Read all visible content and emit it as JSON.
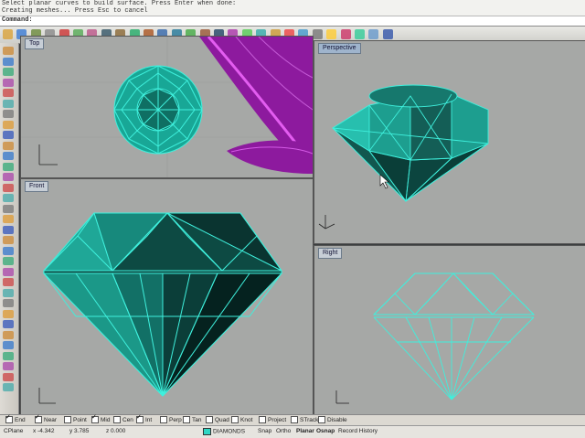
{
  "command": {
    "history_line_1": "Select planar curves to build surface. Press Enter when done:",
    "history_line_2": "Creating meshes... Press Esc to cancel",
    "prompt": "Command:"
  },
  "viewports": {
    "top": {
      "title": "Top"
    },
    "perspective": {
      "title": "Perspective"
    },
    "front": {
      "title": "Front"
    },
    "right": {
      "title": "Right"
    }
  },
  "osnap": {
    "items": [
      {
        "label": "End",
        "checked": true
      },
      {
        "label": "Near",
        "checked": true
      },
      {
        "label": "Point",
        "checked": false
      },
      {
        "label": "Mid",
        "checked": true
      },
      {
        "label": "Cen",
        "checked": false
      },
      {
        "label": "Int",
        "checked": true
      },
      {
        "label": "Perp",
        "checked": false
      },
      {
        "label": "Tan",
        "checked": false
      },
      {
        "label": "Quad",
        "checked": false
      },
      {
        "label": "Knot",
        "checked": false
      },
      {
        "label": "Project",
        "checked": false
      },
      {
        "label": "STrack",
        "checked": false
      },
      {
        "label": "Disable",
        "checked": false
      }
    ]
  },
  "status": {
    "cplane": "CPlane",
    "x": "x -4.342",
    "y": "y 3.785",
    "z": "z 0.000",
    "layer": "DIAMONDS",
    "snap": "Snap",
    "ortho": "Ortho",
    "planar": "Planar",
    "osnap": "Osnap",
    "record_history": "Record History"
  },
  "colors": {
    "gem_wire": "#39f3e0",
    "gem_fill_dark": "#0e4a44",
    "gem_fill_light": "#22b9a6",
    "leaf_magenta": "#9a1aa8",
    "viewport_bg": "#a6a8a6"
  },
  "icons": {
    "toolbar": [
      "new-file-icon",
      "open-icon",
      "save-icon",
      "print-icon",
      "cut-icon",
      "copy-icon",
      "paste-icon",
      "undo-icon",
      "redo-icon",
      "pan-icon",
      "rotate-view-icon",
      "zoom-icon",
      "zoom-window-icon",
      "zoom-extents-icon",
      "zoom-selected-icon",
      "four-viewports-icon",
      "options-icon",
      "wireframe-icon",
      "shaded-icon",
      "rendered-icon",
      "layer-icon",
      "properties-icon",
      "lock-icon",
      "light-icon",
      "render-icon",
      "material-icon",
      "environment-icon",
      "help-icon"
    ]
  }
}
